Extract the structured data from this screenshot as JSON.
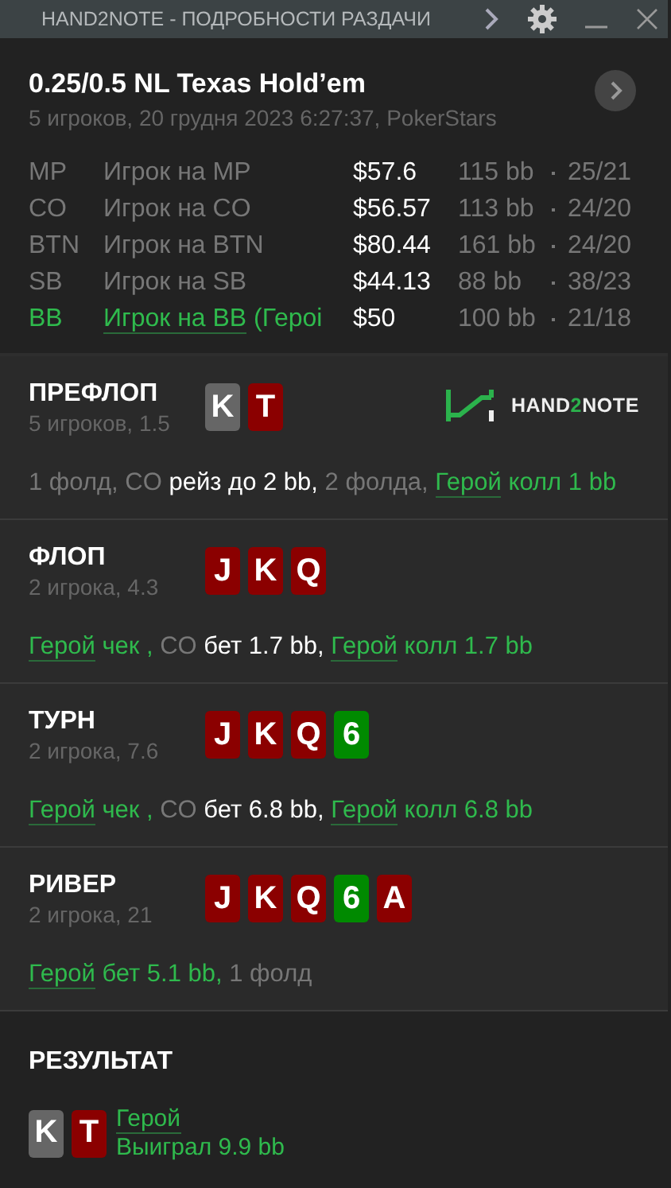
{
  "window": {
    "title": "HAND2NOTE - ПОДРОБНОСТИ РАЗДАЧИ"
  },
  "hand": {
    "game": "0.25/0.5 NL Texas Hold’em",
    "info": "5 игроков, 20 грудня 2023 6:27:37, PokerStars"
  },
  "players": [
    {
      "position": "MP",
      "name": "Игрок на MP",
      "stack": "$57.6",
      "bb": "115 bb",
      "stats": "25/21",
      "hero": false
    },
    {
      "position": "CO",
      "name": "Игрок на CO",
      "stack": "$56.57",
      "bb": "113 bb",
      "stats": "24/20",
      "hero": false
    },
    {
      "position": "BTN",
      "name": "Игрок на BTN",
      "stack": "$80.44",
      "bb": "161 bb",
      "stats": "24/20",
      "hero": false
    },
    {
      "position": "SB",
      "name": "Игрок на SB",
      "stack": "$44.13",
      "bb": "88 bb",
      "stats": "38/23",
      "hero": false
    },
    {
      "position": "BB",
      "name": "Игрок на BB",
      "name_suffix": " (Герoi",
      "stack": "$50",
      "bb": "100 bb",
      "stats": "21/18",
      "hero": true
    }
  ],
  "logo": [
    {
      "text": "HAND",
      "kind": "plain"
    },
    {
      "text": "2",
      "kind": "accent"
    },
    {
      "text": "NOTE",
      "kind": "plain"
    }
  ],
  "streets": [
    {
      "title": "ПРЕФЛОП",
      "info": "5 игроков, 1.5",
      "cards": [
        {
          "rank": "K",
          "color": "#666666"
        },
        {
          "rank": "T",
          "color": "#8b0000"
        }
      ],
      "logo": true,
      "actions": [
        {
          "text": "1 фолд, CO ",
          "kind": "muted"
        },
        {
          "text": "рейз до 2 bb,",
          "kind": "bright"
        },
        {
          "text": " 2 фолда, ",
          "kind": "muted"
        },
        {
          "text": "Герой",
          "kind": "hero-link"
        },
        {
          "text": " колл 1 bb",
          "kind": "hero"
        }
      ]
    },
    {
      "title": "ФЛОП",
      "info": "2 игрока, 4.3",
      "cards": [
        {
          "rank": "J",
          "color": "#8b0000"
        },
        {
          "rank": "K",
          "color": "#8b0000"
        },
        {
          "rank": "Q",
          "color": "#8b0000"
        }
      ],
      "logo": false,
      "actions": [
        {
          "text": "Герой",
          "kind": "hero-link"
        },
        {
          "text": " чек ,",
          "kind": "hero"
        },
        {
          "text": " CO ",
          "kind": "muted"
        },
        {
          "text": "бет 1.7 bb, ",
          "kind": "bright"
        },
        {
          "text": "Герой",
          "kind": "hero-link"
        },
        {
          "text": " колл 1.7 bb",
          "kind": "hero"
        }
      ]
    },
    {
      "title": "ТУРН",
      "info": "2 игрока, 7.6",
      "cards": [
        {
          "rank": "J",
          "color": "#8b0000"
        },
        {
          "rank": "K",
          "color": "#8b0000"
        },
        {
          "rank": "Q",
          "color": "#8b0000"
        },
        {
          "rank": "6",
          "color": "#008a00"
        }
      ],
      "logo": false,
      "actions": [
        {
          "text": "Герой",
          "kind": "hero-link"
        },
        {
          "text": " чек ,",
          "kind": "hero"
        },
        {
          "text": " CO ",
          "kind": "muted"
        },
        {
          "text": "бет 6.8 bb, ",
          "kind": "bright"
        },
        {
          "text": "Герой",
          "kind": "hero-link"
        },
        {
          "text": " колл 6.8 bb",
          "kind": "hero"
        }
      ]
    },
    {
      "title": "РИВЕР",
      "info": "2 игрока, 21",
      "cards": [
        {
          "rank": "J",
          "color": "#8b0000"
        },
        {
          "rank": "K",
          "color": "#8b0000"
        },
        {
          "rank": "Q",
          "color": "#8b0000"
        },
        {
          "rank": "6",
          "color": "#008a00"
        },
        {
          "rank": "A",
          "color": "#8b0000"
        }
      ],
      "logo": false,
      "actions": [
        {
          "text": "Герой",
          "kind": "hero-link"
        },
        {
          "text": " бет 5.1 bb,",
          "kind": "hero"
        },
        {
          "text": " 1 фолд",
          "kind": "muted"
        }
      ]
    }
  ],
  "result": {
    "title": "РЕЗУЛЬТАТ",
    "cards": [
      {
        "rank": "K",
        "color": "#666666"
      },
      {
        "rank": "T",
        "color": "#8b0000"
      }
    ],
    "player": "Герой",
    "outcome": "Выиграл 9.9 bb"
  }
}
